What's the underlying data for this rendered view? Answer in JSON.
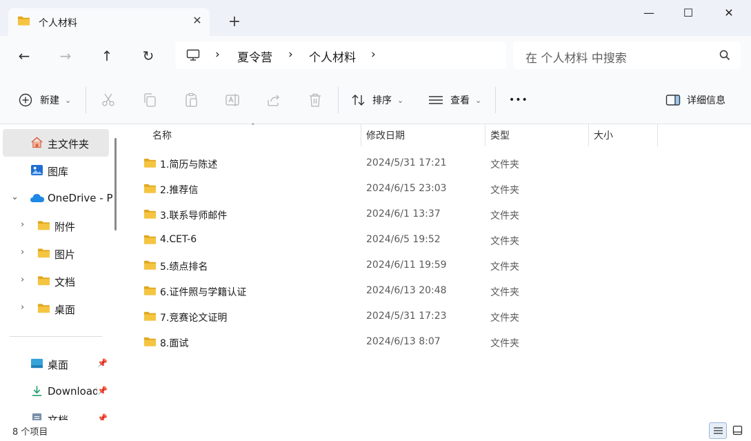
{
  "window": {
    "tab_title": "个人材料",
    "tab_close": "✕",
    "new_tab": "+",
    "minimize": "—",
    "maximize": "☐",
    "close": "✕"
  },
  "nav": {
    "back": "←",
    "forward": "→",
    "up": "↑",
    "refresh": "↻",
    "breadcrumb": [
      "夏令营",
      "个人材料"
    ],
    "separator": "›",
    "search_placeholder": "在 个人材料 中搜索"
  },
  "toolbar": {
    "new_label": "新建",
    "sort_label": "排序",
    "view_label": "查看",
    "more_label": "•••",
    "details_label": "详细信息",
    "dropdown": "⌄"
  },
  "sidebar": {
    "home": "主文件夹",
    "gallery": "图库",
    "onedrive": "OneDrive - P",
    "tree_items": [
      "附件",
      "图片",
      "文档",
      "桌面"
    ],
    "quick_access": [
      "桌面",
      "Download",
      "文档"
    ],
    "chevron_right": "›",
    "chevron_down": "⌄",
    "pin": "📌"
  },
  "columns": {
    "name": "名称",
    "modified": "修改日期",
    "type": "类型",
    "size": "大小",
    "sort_indicator": "˄"
  },
  "files": [
    {
      "name": "1.简历与陈述",
      "modified": "2024/5/31 17:21",
      "type": "文件夹"
    },
    {
      "name": "2.推荐信",
      "modified": "2024/6/15 23:03",
      "type": "文件夹"
    },
    {
      "name": "3.联系导师邮件",
      "modified": "2024/6/1 13:37",
      "type": "文件夹"
    },
    {
      "name": "4.CET-6",
      "modified": "2024/6/5 19:52",
      "type": "文件夹"
    },
    {
      "name": "5.绩点排名",
      "modified": "2024/6/11 19:59",
      "type": "文件夹"
    },
    {
      "name": "6.证件照与学籍认证",
      "modified": "2024/6/13 20:48",
      "type": "文件夹"
    },
    {
      "name": "7.竞赛论文证明",
      "modified": "2024/5/31 17:23",
      "type": "文件夹"
    },
    {
      "name": "8.面试",
      "modified": "2024/6/13 8:07",
      "type": "文件夹"
    }
  ],
  "status": {
    "item_count": "8 个项目"
  },
  "colors": {
    "folder": "#f5c542",
    "folder_dark": "#e0a820",
    "accent": "#0067c0",
    "selected_bg": "#e8e8e8"
  }
}
